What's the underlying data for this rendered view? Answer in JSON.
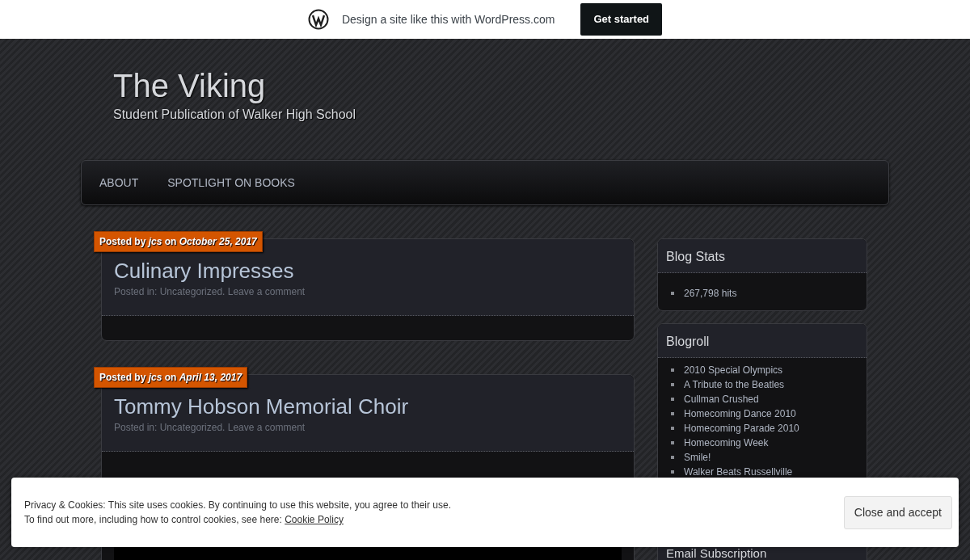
{
  "top_bar": {
    "text": "Design a site like this with WordPress.com",
    "button": "Get started"
  },
  "site": {
    "title": "The Viking",
    "tagline": "Student Publication of Walker High School"
  },
  "nav": [
    {
      "label": "ABOUT"
    },
    {
      "label": "SPOTLIGHT ON BOOKS"
    }
  ],
  "posts": [
    {
      "byline": "Posted by *jcs* on *October 25, 2017*",
      "title": "Culinary Impresses",
      "posted_in": "Posted in:",
      "category": "Uncategorized",
      "separator": ".",
      "comment_link": "Leave a comment",
      "kind": "text"
    },
    {
      "byline": "Posted by *jcs* on *April 13, 2017*",
      "title": "Tommy Hobson Memorial Choir",
      "posted_in": "Posted in:",
      "category": "Uncategorized",
      "separator": ".",
      "comment_link": "Leave a comment",
      "kind": "video"
    }
  ],
  "sidebar": [
    {
      "title": "Blog Stats",
      "items": [
        "267,798 hits"
      ]
    },
    {
      "title": "Blogroll",
      "items": [
        "2010 Special Olympics",
        "A Tribute to the Beatles",
        "Cullman Crushed",
        "Homecoming Dance 2010",
        "Homecoming Parade 2010",
        "Homecoming Week",
        "Smile!",
        "Walker Beats Russellville"
      ]
    },
    {
      "title": "Email Subscription"
    }
  ],
  "cookie_banner": {
    "lines": [
      "Privacy & Cookies: This site uses cookies. By continuing to use this website, you agree to their use.",
      "To find out more, including how to control cookies, see here:"
    ],
    "link": "Cookie Policy",
    "button": "Close and accept"
  }
}
